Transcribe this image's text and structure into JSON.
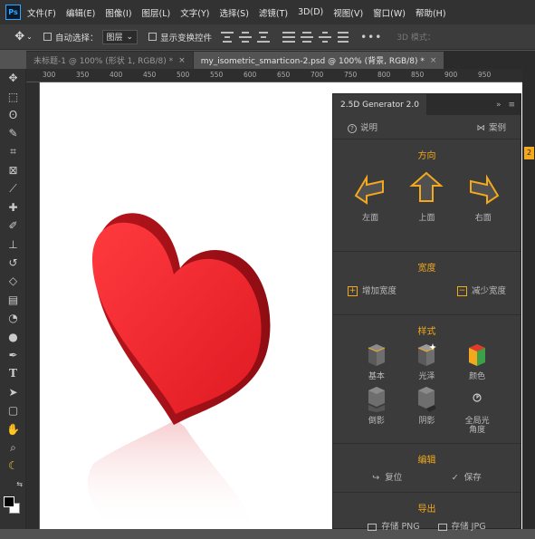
{
  "menubar": {
    "logo": "Ps",
    "items": [
      "文件(F)",
      "编辑(E)",
      "图像(I)",
      "图层(L)",
      "文字(Y)",
      "选择(S)",
      "滤镜(T)",
      "3D(D)",
      "视图(V)",
      "窗口(W)",
      "帮助(H)"
    ]
  },
  "options": {
    "auto_select_label": "自动选择：",
    "auto_select_value": "图层",
    "show_transform_label": "显示变换控件",
    "more": "•••",
    "mode_3d": "3D 模式："
  },
  "tabs": [
    {
      "label": "未标题-1 @ 100% (形状 1, RGB/8) *",
      "close": "×"
    },
    {
      "label": "my_isometric_smarticon-2.psd @ 100% (背景, RGB/8) *",
      "close": "×"
    }
  ],
  "ruler": {
    "marks": [
      "300",
      "350",
      "400",
      "450",
      "500",
      "550",
      "600",
      "650",
      "700",
      "750",
      "800",
      "850",
      "900",
      "950"
    ]
  },
  "panel": {
    "title": "2.5D Generator 2.0",
    "help": "说明",
    "examples": "案例",
    "direction": {
      "title": "方向",
      "left": "左面",
      "top": "上面",
      "right": "右面"
    },
    "width": {
      "title": "宽度",
      "increase": "增加宽度",
      "decrease": "减少宽度"
    },
    "style": {
      "title": "样式",
      "items": [
        "基本",
        "光泽",
        "颜色",
        "倒影",
        "阴影",
        "全局光\n角度"
      ]
    },
    "edit": {
      "title": "编辑",
      "reset": "复位",
      "save": "保存"
    },
    "export": {
      "title": "导出",
      "png": "存储 PNG",
      "jpg": "存储 JPG"
    }
  },
  "side_strip": {
    "badge": "2"
  },
  "colors": {
    "accent": "#f3a81d",
    "heart": "#e8202a"
  }
}
